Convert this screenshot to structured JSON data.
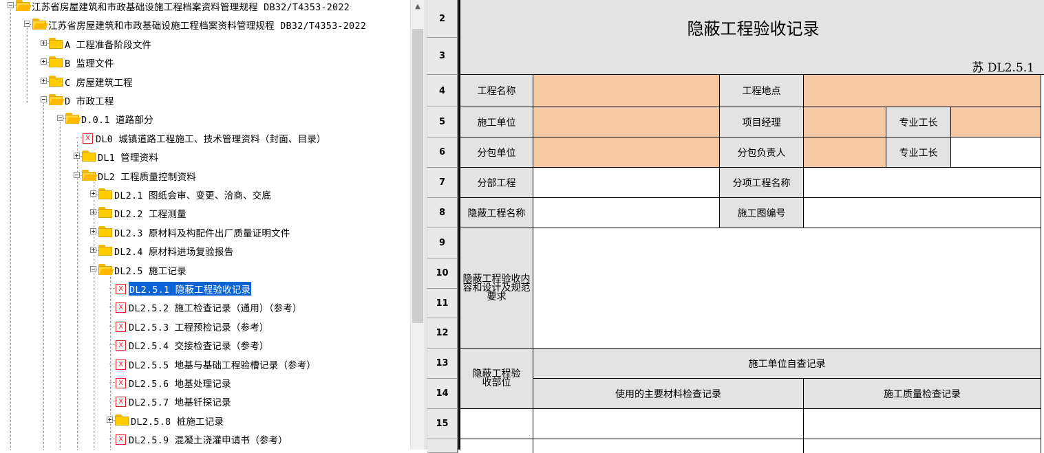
{
  "tree": {
    "items": [
      {
        "label": "江苏省房屋建筑和市政基础设施工程档案资料管理规程 DB32/T4353-2022",
        "type": "folder-open",
        "expander": "minus"
      },
      {
        "label": "江苏省房屋建筑和市政基础设施工程档案资料管理规程 DB32/T4353-2022",
        "type": "folder-open",
        "expander": "minus"
      },
      {
        "label": "A 工程准备阶段文件",
        "type": "folder",
        "expander": "plus"
      },
      {
        "label": "B 监理文件",
        "type": "folder",
        "expander": "plus"
      },
      {
        "label": "C 房屋建筑工程",
        "type": "folder",
        "expander": "plus"
      },
      {
        "label": "D 市政工程",
        "type": "folder-open",
        "expander": "minus"
      },
      {
        "label": "D.0.1 道路部分",
        "type": "folder-open",
        "expander": "minus"
      },
      {
        "label": "DL0 城镇道路工程施工、技术管理资料（封面、目录）",
        "type": "file",
        "expander": ""
      },
      {
        "label": "DL1 管理资料",
        "type": "folder",
        "expander": "plus"
      },
      {
        "label": "DL2 工程质量控制资料",
        "type": "folder-open",
        "expander": "minus"
      },
      {
        "label": "DL2.1 图纸会审、变更、洽商、交底",
        "type": "folder",
        "expander": "plus"
      },
      {
        "label": "DL2.2 工程测量",
        "type": "folder",
        "expander": "plus"
      },
      {
        "label": "DL2.3 原材料及构配件出厂质量证明文件",
        "type": "folder",
        "expander": "plus"
      },
      {
        "label": "DL2.4 原材料进场复验报告",
        "type": "folder",
        "expander": "plus"
      },
      {
        "label": "DL2.5 施工记录",
        "type": "folder-open",
        "expander": "minus"
      },
      {
        "label": "DL2.5.1 隐蔽工程验收记录",
        "type": "file",
        "expander": "",
        "selected": true
      },
      {
        "label": "DL2.5.2 施工检查记录（通用）（参考）",
        "type": "file",
        "expander": ""
      },
      {
        "label": "DL2.5.3 工程预检记录（参考）",
        "type": "file",
        "expander": ""
      },
      {
        "label": "DL2.5.4 交接检查记录（参考）",
        "type": "file",
        "expander": ""
      },
      {
        "label": "DL2.5.5 地基与基础工程验槽记录（参考）",
        "type": "file",
        "expander": ""
      },
      {
        "label": "DL2.5.6 地基处理记录",
        "type": "file",
        "expander": ""
      },
      {
        "label": "DL2.5.7 地基钎探记录",
        "type": "file",
        "expander": ""
      },
      {
        "label": "DL2.5.8 桩施工记录",
        "type": "folder",
        "expander": "plus"
      },
      {
        "label": "DL2.5.9 混凝土浇灌申请书（参考）",
        "type": "file",
        "expander": ""
      }
    ],
    "file_glyph": "X"
  },
  "scrollbar": {
    "up_arrow": "▲"
  },
  "sheet": {
    "row_numbers": [
      "2",
      "3",
      "4",
      "5",
      "6",
      "7",
      "8",
      "9",
      "10",
      "11",
      "12",
      "13",
      "14",
      "15"
    ],
    "title": "隐蔽工程验收记录",
    "code": "苏 DL2.5.1",
    "labels": {
      "project_name": "工程名称",
      "project_location": "工程地点",
      "construction_unit": "施工单位",
      "project_manager": "项目经理",
      "foreman_1": "专业工长",
      "subcontractor": "分包单位",
      "sub_leader": "分包负责人",
      "foreman_2": "专业工长",
      "division": "分部工程",
      "subitem_name": "分项工程名称",
      "hidden_name": "隐蔽工程名称",
      "drawing_no": "施工图编号",
      "hidden_content": "隐蔽工程验收内容和设计及规范要求",
      "hidden_part": "隐蔽工程验收部位",
      "self_check": "施工单位自查记录",
      "material_check": "使用的主要材料检查记录",
      "quality_check": "施工质量检查记录"
    }
  },
  "colors": {
    "peach": "#f4c9a3",
    "header_gray": "#e3e3e3",
    "selection": "#0a64d6",
    "folder": "#ffcc00",
    "file_red": "#e02020"
  }
}
